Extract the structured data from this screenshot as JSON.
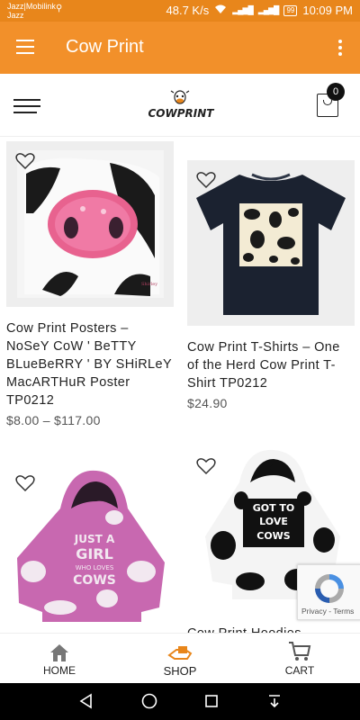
{
  "status_bar": {
    "carrier_line1": "Jazz|Mobilink",
    "carrier_line2": "Jazz",
    "network_speed": "48.7 K/s",
    "battery": "99",
    "time": "10:09 PM"
  },
  "app_bar": {
    "title": "Cow Print"
  },
  "header": {
    "logo_text": "COWPRINT",
    "cart_count": "0"
  },
  "products": [
    {
      "name": "Cow Print Posters – NoSeY CoW ' BeTTY BLueBeRRY ' BY SHiRLeY MacARTHuR Poster TP0212",
      "price": "$8.00 – $117.00",
      "image": "cow-face-painting"
    },
    {
      "name": "Cow Print T-Shirts – One of the Herd Cow Print T-Shirt TP0212",
      "price": "$24.90",
      "image": "black-tshirt-cow-print"
    },
    {
      "name": "",
      "price": "",
      "image": "pink-cow-hoodie",
      "print_text": "JUST A GIRL WHO LOVES COWS"
    },
    {
      "name": "Cow Print Hoodies",
      "price": "",
      "image": "black-white-cow-hoodie",
      "print_text": "GOT TO LOVE COWS"
    }
  ],
  "recaptcha": {
    "links": "Privacy - Terms"
  },
  "bottom_nav": [
    {
      "label": "HOME",
      "icon": "home-icon"
    },
    {
      "label": "SHOP",
      "icon": "shop-icon"
    },
    {
      "label": "CART",
      "icon": "cart-icon"
    }
  ],
  "colors": {
    "accent": "#f2902a",
    "status_bar": "#e8861b",
    "shop_accent": "#e8861b"
  }
}
